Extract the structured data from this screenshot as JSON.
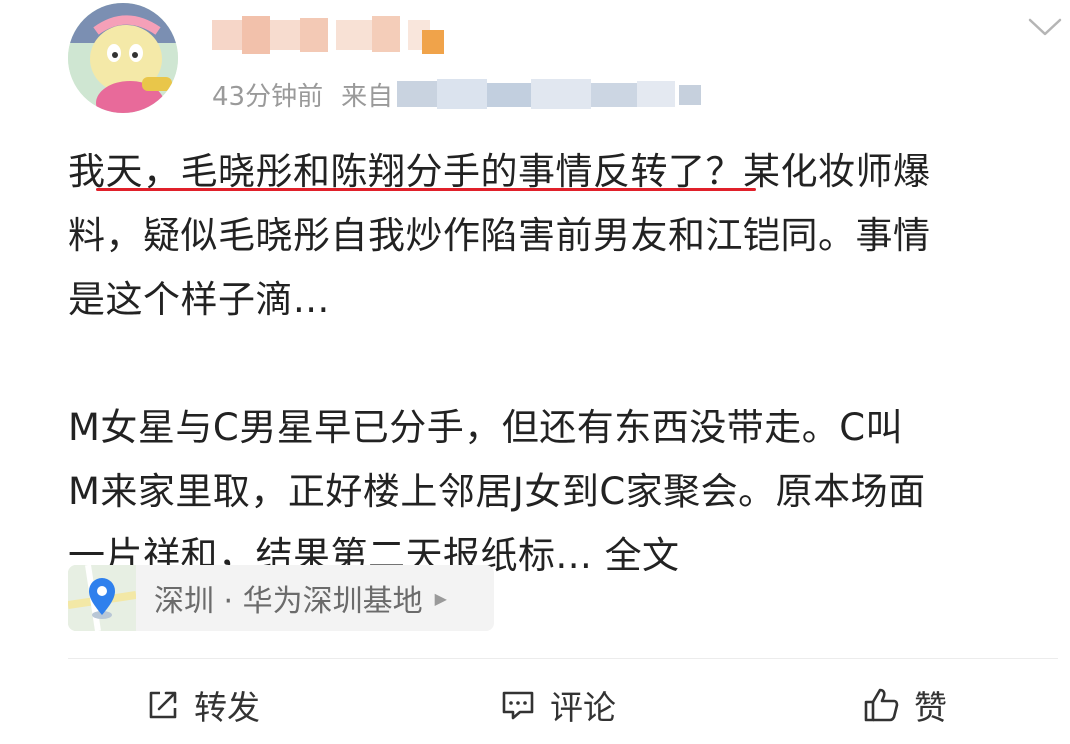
{
  "header": {
    "time": "43分钟前",
    "source_prefix": "来自",
    "avatar_icon": "user-avatar-icon",
    "menu_icon": "chevron-down-icon"
  },
  "post": {
    "para1_line1": "我天，毛晓彤和陈翔分手的事情反转了？某化妆师爆",
    "para1_line2": "料，疑似毛晓彤自我炒作陷害前男友和江铠同。事情",
    "para1_line3": "是这个样子滴...",
    "para2_line1": "M女星与C男星早已分手，但还有东西没带走。C叫",
    "para2_line2": "M来家里取，正好楼上邻居J女到C家聚会。原本场面",
    "para2_line3": "一片祥和，结果第二天报纸标...",
    "full_text_link": "全文",
    "highlight_color": "#e0202a"
  },
  "location": {
    "label": "深圳 · 华为深圳基地",
    "icon": "location-pin-icon",
    "pin_color": "#2f80ed"
  },
  "actions": {
    "repost_label": "转发",
    "comment_label": "评论",
    "like_label": "赞"
  }
}
